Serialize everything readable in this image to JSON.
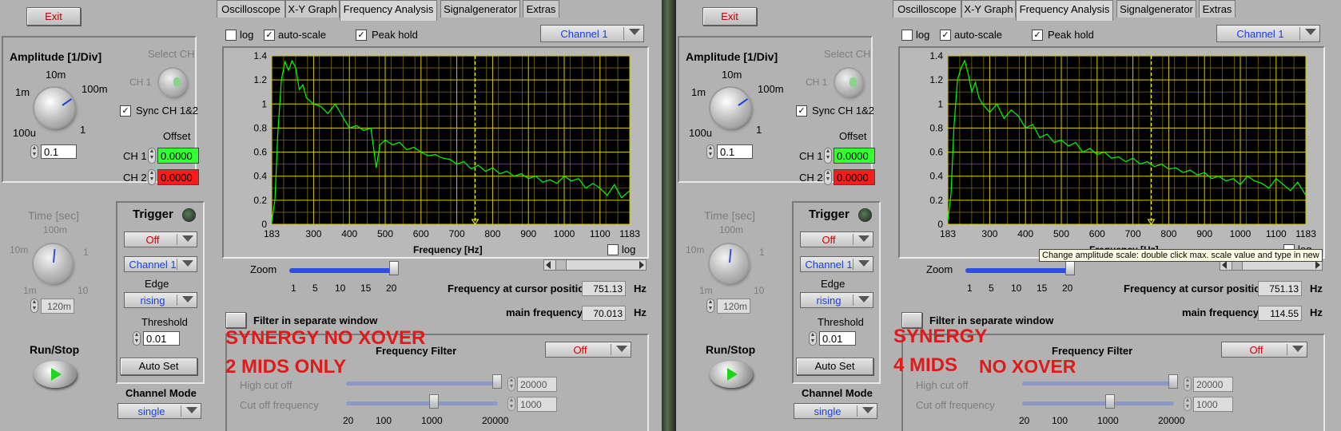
{
  "panels": [
    {
      "exit_label": "Exit",
      "tabs": [
        "Oscilloscope",
        "X-Y Graph",
        "Frequency Analysis",
        "Signalgenerator",
        "Extras"
      ],
      "active_tab": "Frequency Analysis",
      "amplitude": {
        "title": "Amplitude [1/Div]",
        "scale_labels": [
          "10m",
          "1m",
          "100m",
          "100u",
          "1"
        ],
        "value": "0.1"
      },
      "select_ch": {
        "title": "Select CH",
        "ch_label": "CH 1",
        "sync_label": "Sync CH 1&2"
      },
      "offset": {
        "title": "Offset",
        "ch1_label": "CH 1",
        "ch1_value": "0.0000",
        "ch2_label": "CH 2",
        "ch2_value": "0.0000"
      },
      "time": {
        "title": "Time [sec]",
        "scale_labels": [
          "100m",
          "10m",
          "1",
          "1m",
          "10"
        ],
        "value": "120m"
      },
      "trigger": {
        "title": "Trigger",
        "mode": "Off",
        "channel": "Channel 1",
        "edge_label": "Edge",
        "edge": "rising",
        "threshold_label": "Threshold",
        "threshold": "0.01",
        "auto_set": "Auto Set"
      },
      "run_stop": "Run/Stop",
      "channel_mode": {
        "label": "Channel Mode",
        "value": "single"
      },
      "graph_opts": {
        "log": "log",
        "auto_scale": "auto-scale",
        "peak_hold": "Peak hold",
        "channel": "Channel 1"
      },
      "x_axis_label": "Frequency [Hz]",
      "x_log": "log",
      "zoom": {
        "label": "Zoom",
        "ticks": [
          "1",
          "5",
          "10",
          "15",
          "20"
        ],
        "level": 1.0
      },
      "cursor_freq": {
        "label": "Frequency at cursor position",
        "value": "751.13",
        "unit": "Hz"
      },
      "main_freq": {
        "label": "main frequency",
        "value": "70.013",
        "unit": "Hz"
      },
      "filter_window": "Filter in separate window",
      "freq_filter": {
        "title": "Frequency Filter",
        "mode": "Off",
        "high_label": "High cut off",
        "high_value": "20000",
        "cut_label": "Cut off frequency",
        "cut_value": "1000",
        "ticks": [
          "20",
          "100",
          "1000",
          "20000"
        ]
      },
      "annotation_lines": [
        "SYNERGY NO XOVER",
        "2 MIDS ONLY"
      ],
      "chart_data": {
        "type": "line",
        "x_ticks": [
          "183",
          "300",
          "400",
          "500",
          "600",
          "700",
          "800",
          "900",
          "1000",
          "1100",
          "1183"
        ],
        "y_ticks": [
          "1.4",
          "1.2",
          "1",
          "0.8",
          "0.6",
          "0.4",
          "0.2",
          "0"
        ],
        "xlim": [
          183,
          1183
        ],
        "ylim": [
          0,
          1.4
        ],
        "xlabel": "Frequency [Hz]",
        "cursor_x": 751.13,
        "grid": true,
        "series": [
          {
            "x": [
              183,
              192,
              200,
              210,
              220,
              230,
              240,
              250,
              260,
              270,
              280,
              300,
              320,
              340,
              360,
              380,
              400,
              420,
              440,
              460,
              475,
              485,
              500,
              520,
              540,
              560,
              580,
              600,
              620,
              640,
              660,
              680,
              700,
              720,
              740,
              760,
              780,
              800,
              820,
              840,
              860,
              880,
              900,
              920,
              940,
              960,
              980,
              1000,
              1020,
              1040,
              1060,
              1080,
              1100,
              1120,
              1140,
              1160,
              1183
            ],
            "y": [
              0.02,
              0.2,
              0.75,
              1.2,
              1.35,
              1.28,
              1.36,
              1.3,
              1.12,
              1.16,
              1.05,
              1.0,
              0.98,
              0.92,
              1.0,
              0.9,
              0.8,
              0.82,
              0.78,
              0.8,
              0.47,
              0.66,
              0.7,
              0.66,
              0.68,
              0.62,
              0.64,
              0.6,
              0.57,
              0.58,
              0.55,
              0.54,
              0.5,
              0.52,
              0.46,
              0.49,
              0.44,
              0.47,
              0.42,
              0.44,
              0.4,
              0.42,
              0.38,
              0.4,
              0.35,
              0.37,
              0.34,
              0.4,
              0.36,
              0.38,
              0.3,
              0.34,
              0.3,
              0.24,
              0.33,
              0.22,
              0.28
            ]
          }
        ]
      }
    },
    {
      "exit_label": "Exit",
      "tabs": [
        "Oscilloscope",
        "X-Y Graph",
        "Frequency Analysis",
        "Signalgenerator",
        "Extras"
      ],
      "active_tab": "Frequency Analysis",
      "amplitude": {
        "title": "Amplitude [1/Div]",
        "scale_labels": [
          "10m",
          "1m",
          "100m",
          "100u",
          "1"
        ],
        "value": "0.1"
      },
      "select_ch": {
        "title": "Select CH",
        "ch_label": "CH 1",
        "sync_label": "Sync CH 1&2"
      },
      "offset": {
        "title": "Offset",
        "ch1_label": "CH 1",
        "ch1_value": "0.0000",
        "ch2_label": "CH 2",
        "ch2_value": "0.0000"
      },
      "time": {
        "title": "Time [sec]",
        "scale_labels": [
          "100m",
          "10m",
          "1",
          "1m",
          "10"
        ],
        "value": "120m"
      },
      "trigger": {
        "title": "Trigger",
        "mode": "Off",
        "channel": "Channel 1",
        "edge_label": "Edge",
        "edge": "rising",
        "threshold_label": "Threshold",
        "threshold": "0.01",
        "auto_set": "Auto Set"
      },
      "run_stop": "Run/Stop",
      "channel_mode": {
        "label": "Channel Mode",
        "value": "single"
      },
      "graph_opts": {
        "log": "log",
        "auto_scale": "auto-scale",
        "peak_hold": "Peak hold",
        "channel": "Channel 1"
      },
      "x_axis_label": "Frequency [Hz]",
      "x_log": "log",
      "tooltip": "Change amplitude scale: double click max. scale value and type in new",
      "zoom": {
        "label": "Zoom",
        "ticks": [
          "1",
          "5",
          "10",
          "15",
          "20"
        ],
        "level": 1.0
      },
      "cursor_freq": {
        "label": "Frequency at cursor position",
        "value": "751.13",
        "unit": "Hz"
      },
      "main_freq": {
        "label": "main frequency",
        "value": "114.55",
        "unit": "Hz"
      },
      "filter_window": "Filter in separate window",
      "freq_filter": {
        "title": "Frequency Filter",
        "mode": "Off",
        "high_label": "High cut off",
        "high_value": "20000",
        "cut_label": "Cut off frequency",
        "cut_value": "1000",
        "ticks": [
          "20",
          "100",
          "1000",
          "20000"
        ]
      },
      "annotation_lines": [
        "SYNERGY",
        "4 MIDS",
        "NO XOVER"
      ],
      "chart_data": {
        "type": "line",
        "x_ticks": [
          "183",
          "300",
          "400",
          "500",
          "600",
          "700",
          "800",
          "900",
          "1000",
          "1100",
          "1183"
        ],
        "y_ticks": [
          "1.4",
          "1.2",
          "1",
          "0.8",
          "0.6",
          "0.4",
          "0.2",
          "0"
        ],
        "xlim": [
          183,
          1183
        ],
        "ylim": [
          0,
          1.4
        ],
        "xlabel": "Frequency [Hz]",
        "cursor_x": 751.13,
        "grid": true,
        "series": [
          {
            "x": [
              183,
              192,
              200,
              210,
              220,
              230,
              240,
              250,
              260,
              270,
              280,
              300,
              320,
              340,
              360,
              380,
              400,
              420,
              440,
              460,
              480,
              500,
              520,
              540,
              560,
              580,
              600,
              620,
              640,
              660,
              680,
              700,
              720,
              740,
              760,
              780,
              800,
              820,
              840,
              860,
              880,
              900,
              920,
              940,
              960,
              980,
              1000,
              1020,
              1040,
              1060,
              1080,
              1100,
              1120,
              1140,
              1160,
              1183
            ],
            "y": [
              0.03,
              0.25,
              0.8,
              1.2,
              1.3,
              1.36,
              1.25,
              1.1,
              1.18,
              1.05,
              1.0,
              0.93,
              1.0,
              0.88,
              0.95,
              0.9,
              0.8,
              0.83,
              0.72,
              0.75,
              0.68,
              0.7,
              0.65,
              0.68,
              0.6,
              0.63,
              0.58,
              0.6,
              0.55,
              0.56,
              0.52,
              0.55,
              0.5,
              0.52,
              0.48,
              0.5,
              0.46,
              0.47,
              0.43,
              0.45,
              0.41,
              0.43,
              0.38,
              0.4,
              0.36,
              0.38,
              0.33,
              0.4,
              0.36,
              0.34,
              0.3,
              0.38,
              0.33,
              0.28,
              0.35,
              0.24
            ]
          }
        ]
      }
    }
  ]
}
